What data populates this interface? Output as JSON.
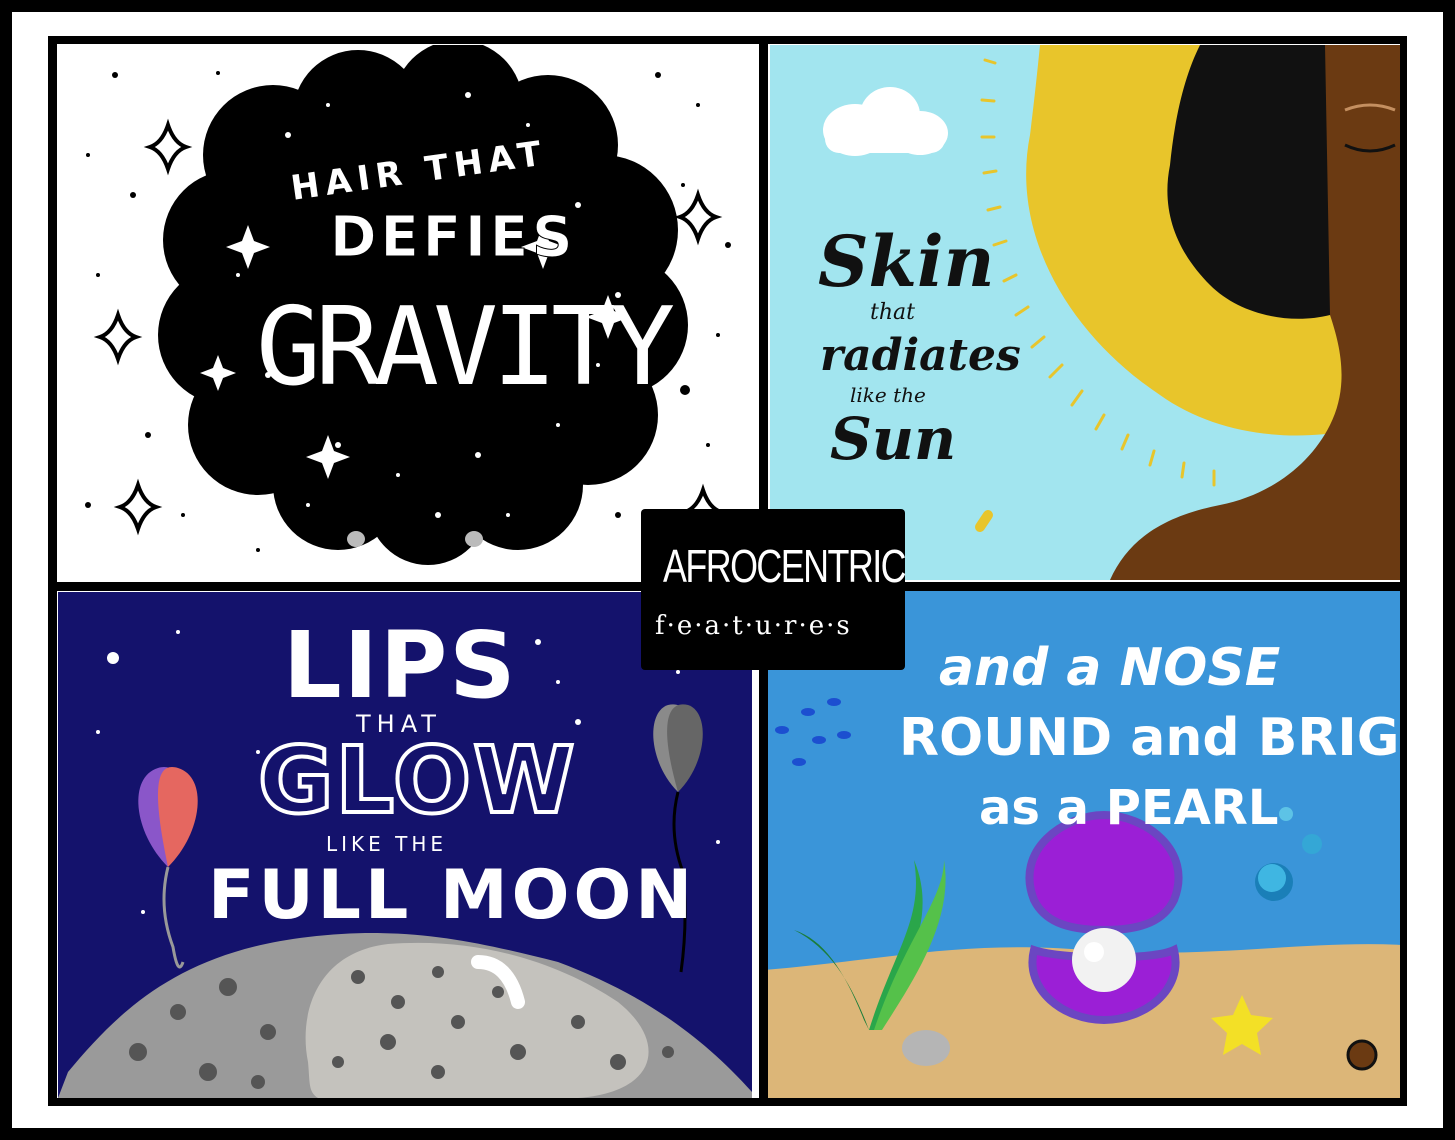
{
  "hair": {
    "line1": "HAIR THAT",
    "line2": "DEFIES",
    "line3": "GRAVITY"
  },
  "skin": {
    "line1": "Skin",
    "line2": "that",
    "line3": "radiates",
    "line4": "like the",
    "line5": "Sun"
  },
  "lips": {
    "line1": "LIPS",
    "line2": "THAT",
    "line3": "GLOW",
    "line4": "LIKE THE",
    "line5": "FULL MOON"
  },
  "nose": {
    "line1": "and a NOSE",
    "line2": "ROUND and BRIGHT",
    "line3": "as a PEARL"
  },
  "center_title": {
    "line1": "AFROCENTRIC",
    "line2": "f·e·a·t·u·r·e·s"
  },
  "colors": {
    "sky": "#a2e5ef",
    "sun": "#e8c52b",
    "skin_tone": "#6b3a12",
    "night": "#14126c",
    "ocean": "#3a95d9",
    "sand": "#dcb678",
    "shell": "#9b1fd6",
    "moon": "#9a9a9a"
  }
}
